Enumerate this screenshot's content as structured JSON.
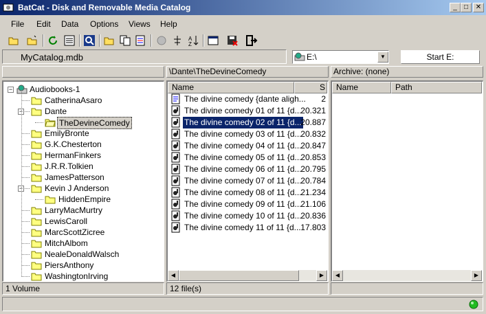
{
  "window": {
    "title": "BatCat - Disk and Removable Media Catalog"
  },
  "menu": [
    "File",
    "Edit",
    "Data",
    "Options",
    "Views",
    "Help"
  ],
  "toolbar": {
    "icons": [
      "open-folder-icon",
      "new-folder-icon",
      "refresh-icon",
      "list-view-icon",
      "find-icon",
      "folder-icon",
      "copy-icon",
      "report-icon",
      "scan-icon",
      "tree-icon",
      "sort-icon",
      "properties-icon",
      "save-delete-icon",
      "exit-icon"
    ]
  },
  "catalog": {
    "file": "MyCatalog.mdb"
  },
  "drive": {
    "selected": "E:\\",
    "start_label": "Start E:"
  },
  "tree": {
    "header": "",
    "root": "Audiobooks-1",
    "items": [
      {
        "label": "CatherinaAsaro",
        "level": 1
      },
      {
        "label": "Dante",
        "level": 1,
        "expanded": true
      },
      {
        "label": "TheDevineComedy",
        "level": 2,
        "selected": true
      },
      {
        "label": "EmilyBronte",
        "level": 1
      },
      {
        "label": "G.K.Chesterton",
        "level": 1
      },
      {
        "label": "HermanFinkers",
        "level": 1
      },
      {
        "label": "J.R.R.Tolkien",
        "level": 1
      },
      {
        "label": "JamesPatterson",
        "level": 1
      },
      {
        "label": "Kevin J Anderson",
        "level": 1,
        "expanded": true
      },
      {
        "label": "HiddenEmpire",
        "level": 2
      },
      {
        "label": "LarryMacMurtry",
        "level": 1
      },
      {
        "label": "LewisCaroll",
        "level": 1
      },
      {
        "label": "MarcScottZicree",
        "level": 1
      },
      {
        "label": "MitchAlbom",
        "level": 1
      },
      {
        "label": "NealeDonaldWalsch",
        "level": 1
      },
      {
        "label": "PiersAnthony",
        "level": 1
      },
      {
        "label": "WashingtonIrving",
        "level": 1
      }
    ],
    "status": "1 Volume"
  },
  "files": {
    "path": "\\Dante\\TheDevineComedy",
    "columns": {
      "name": "Name",
      "size": "S"
    },
    "rows": [
      {
        "name": "The divine comedy {dante aligh...",
        "size": "2",
        "type": "doc"
      },
      {
        "name": "The divine comedy 01 of 11 {d...",
        "size": "20.321",
        "type": "audio"
      },
      {
        "name": "The divine comedy 02 of 11 {d...",
        "size": "20.887",
        "type": "audio",
        "selected": true
      },
      {
        "name": "The divine comedy 03 of 11 {d...",
        "size": "20.832",
        "type": "audio"
      },
      {
        "name": "The divine comedy 04 of 11 {d...",
        "size": "20.847",
        "type": "audio"
      },
      {
        "name": "The divine comedy 05 of 11 {d...",
        "size": "20.853",
        "type": "audio"
      },
      {
        "name": "The divine comedy 06 of 11 {d...",
        "size": "20.795",
        "type": "audio"
      },
      {
        "name": "The divine comedy 07 of 11 {d...",
        "size": "20.784",
        "type": "audio"
      },
      {
        "name": "The divine comedy 08 of 11 {d...",
        "size": "21.234",
        "type": "audio"
      },
      {
        "name": "The divine comedy 09 of 11 {d...",
        "size": "21.106",
        "type": "audio"
      },
      {
        "name": "The divine comedy 10 of 11 {d...",
        "size": "20.836",
        "type": "audio"
      },
      {
        "name": "The divine comedy 11 of 11 {d...",
        "size": "17.803",
        "type": "audio"
      }
    ],
    "status": "12 file(s)"
  },
  "archive": {
    "header": "Archive: (none)",
    "columns": {
      "name": "Name",
      "path": "Path"
    }
  },
  "colors": {
    "selection": "#0a246a",
    "titlebar_start": "#0a246a",
    "titlebar_end": "#a6caf0",
    "folder": "#ffff80",
    "status_light": "#22bb22"
  }
}
